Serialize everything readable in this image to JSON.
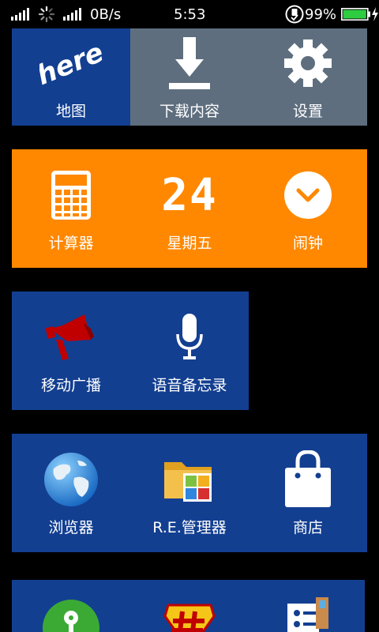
{
  "status_bar": {
    "network_speed": "0B/s",
    "time": "5:53",
    "battery_percent": "99%",
    "battery_level": 0.99,
    "icons": [
      "signal-icon",
      "loading-icon",
      "signal-icon",
      "usb-debug-icon",
      "battery-icon",
      "charging-icon"
    ]
  },
  "colors": {
    "blue": "#133F91",
    "gray": "#5E6E7E",
    "orange": "#FF8800",
    "battery_green": "#2ECC40"
  },
  "rows": [
    {
      "tiles": [
        {
          "label": "地图",
          "icon": "here-maps-icon"
        },
        {
          "label": "下载内容",
          "icon": "download-icon"
        },
        {
          "label": "设置",
          "icon": "gear-icon"
        }
      ]
    },
    {
      "tiles": [
        {
          "label": "计算器",
          "icon": "calculator-icon"
        },
        {
          "label": "星期五",
          "icon": "date-number",
          "big_text": "24"
        },
        {
          "label": "闹钟",
          "icon": "alarm-chevron-icon"
        }
      ]
    },
    {
      "tiles": [
        {
          "label": "移动广播",
          "icon": "megaphone-icon"
        },
        {
          "label": "语音备忘录",
          "icon": "microphone-icon"
        }
      ]
    },
    {
      "tiles": [
        {
          "label": "浏览器",
          "icon": "globe-icon"
        },
        {
          "label": "R.E.管理器",
          "icon": "folder-icon"
        },
        {
          "label": "商店",
          "icon": "shopping-bag-icon"
        }
      ]
    },
    {
      "tiles": [
        {
          "label": "",
          "icon": "key-icon"
        },
        {
          "label": "",
          "icon": "hash-badge-icon"
        },
        {
          "label": "",
          "icon": "contacts-icon"
        }
      ]
    }
  ]
}
